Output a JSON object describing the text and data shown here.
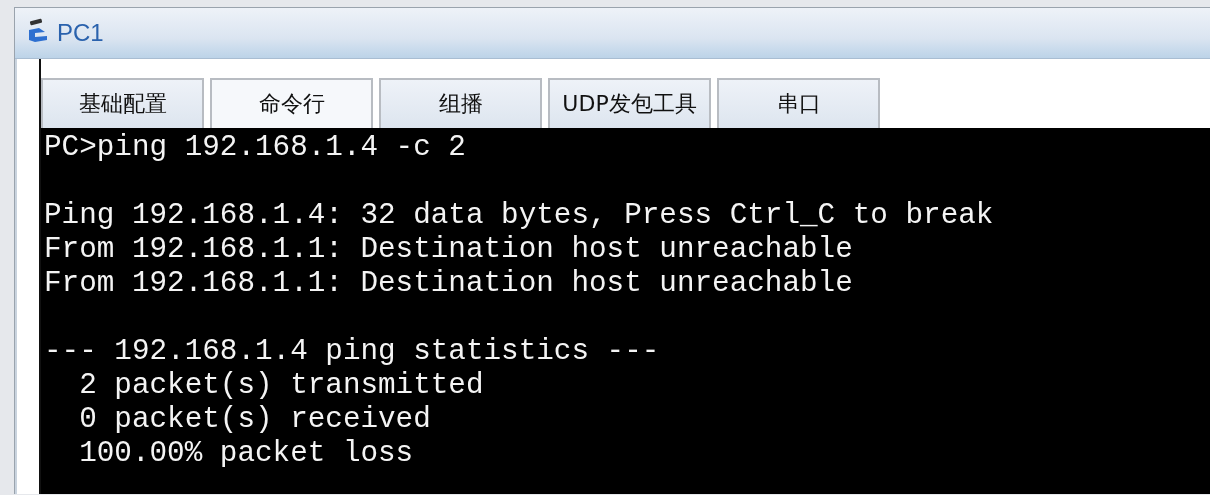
{
  "window": {
    "title": "PC1"
  },
  "tabs": [
    {
      "label": "基础配置",
      "selected": false
    },
    {
      "label": "命令行",
      "selected": true
    },
    {
      "label": "组播",
      "selected": false
    },
    {
      "label": "UDP发包工具",
      "selected": false
    },
    {
      "label": "串口",
      "selected": false
    }
  ],
  "terminal": {
    "blocks": [
      [
        "PC>ping 192.168.1.4 -c 2"
      ],
      [
        "Ping 192.168.1.4: 32 data bytes, Press Ctrl_C to break",
        "From 192.168.1.1: Destination host unreachable",
        "From 192.168.1.1: Destination host unreachable"
      ],
      [
        "--- 192.168.1.4 ping statistics ---",
        "  2 packet(s) transmitted",
        "  0 packet(s) received",
        "  100.00% packet loss"
      ]
    ]
  }
}
